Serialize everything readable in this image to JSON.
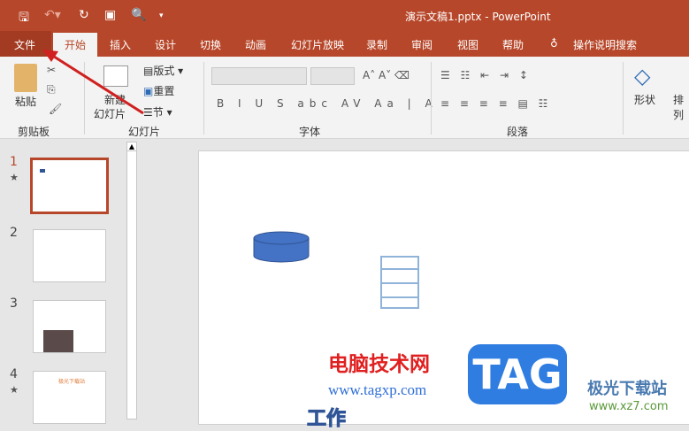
{
  "titlebar": {
    "title": "演示文稿1.pptx  -  PowerPoint"
  },
  "tabs": {
    "file": "文件",
    "home": "开始",
    "insert": "插入",
    "design": "设计",
    "transitions": "切换",
    "animations": "动画",
    "slideshow": "幻灯片放映",
    "record": "录制",
    "review": "审阅",
    "view": "视图",
    "help": "帮助",
    "search": "操作说明搜索"
  },
  "ribbon": {
    "paste": "粘贴",
    "clipboard": "剪贴板",
    "new_slide_1": "新建",
    "new_slide_2": "幻灯片",
    "layout": "版式",
    "reset": "重置",
    "section": "节",
    "slides": "幻灯片",
    "font": "字体",
    "paragraph": "段落",
    "shapes": "形状",
    "arrange": "排列"
  },
  "slides": [
    {
      "num": "1",
      "star": "★"
    },
    {
      "num": "2"
    },
    {
      "num": "3"
    },
    {
      "num": "4",
      "star": "★"
    }
  ],
  "thumb4_title": "极光下载站",
  "slide": {
    "bottom_text": "工作"
  },
  "watermark": {
    "cn": "电脑技术网",
    "url": "www.tagxp.com",
    "tag": "TAG",
    "site": "极光下载站",
    "site_url": "www.xz7.com"
  },
  "colors": {
    "accent": "#b7472a",
    "shape": "#4472c4"
  }
}
